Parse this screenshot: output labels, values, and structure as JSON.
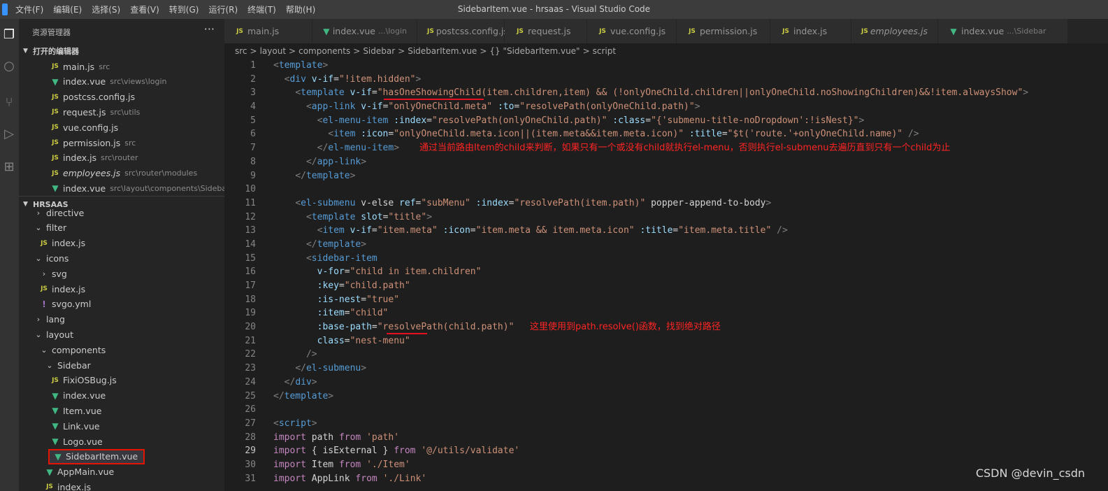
{
  "menu": [
    "文件(F)",
    "编辑(E)",
    "选择(S)",
    "查看(V)",
    "转到(G)",
    "运行(R)",
    "终端(T)",
    "帮助(H)"
  ],
  "window_title": "SidebarItem.vue - hrsaas - Visual Studio Code",
  "activity_icons": [
    "files-icon",
    "search-icon",
    "source-control-icon",
    "run-debug-icon",
    "extensions-icon"
  ],
  "explorer": {
    "title": "资源管理器",
    "more": "···",
    "open_editors_label": "打开的编辑器",
    "open_editors": [
      {
        "name": "main.js",
        "path": "src",
        "type": "js"
      },
      {
        "name": "index.vue",
        "path": "src\\views\\login",
        "type": "vue"
      },
      {
        "name": "postcss.config.js",
        "path": "",
        "type": "js"
      },
      {
        "name": "request.js",
        "path": "src\\utils",
        "type": "js"
      },
      {
        "name": "vue.config.js",
        "path": "",
        "type": "js"
      },
      {
        "name": "permission.js",
        "path": "src",
        "type": "js"
      },
      {
        "name": "index.js",
        "path": "src\\router",
        "type": "js"
      },
      {
        "name": "employees.js",
        "path": "src\\router\\modules",
        "type": "js",
        "italic": true
      },
      {
        "name": "index.vue",
        "path": "src\\layout\\components\\Sidebar",
        "type": "vue"
      }
    ],
    "project_label": "HRSAAS",
    "tree": [
      {
        "name": "directive",
        "type": "folder",
        "depth": 1,
        "open": false
      },
      {
        "name": "filter",
        "type": "folder",
        "depth": 1,
        "open": true
      },
      {
        "name": "index.js",
        "type": "js",
        "depth": 2
      },
      {
        "name": "icons",
        "type": "folder",
        "depth": 1,
        "open": true
      },
      {
        "name": "svg",
        "type": "folder",
        "depth": 2,
        "open": false
      },
      {
        "name": "index.js",
        "type": "js",
        "depth": 2
      },
      {
        "name": "svgo.yml",
        "type": "yml",
        "depth": 2
      },
      {
        "name": "lang",
        "type": "folder",
        "depth": 1,
        "open": false
      },
      {
        "name": "layout",
        "type": "folder",
        "depth": 1,
        "open": true
      },
      {
        "name": "components",
        "type": "folder",
        "depth": 2,
        "open": true
      },
      {
        "name": "Sidebar",
        "type": "folder",
        "depth": 3,
        "open": true
      },
      {
        "name": "FixiOSBug.js",
        "type": "js",
        "depth": 4
      },
      {
        "name": "index.vue",
        "type": "vue",
        "depth": 4
      },
      {
        "name": "Item.vue",
        "type": "vue",
        "depth": 4
      },
      {
        "name": "Link.vue",
        "type": "vue",
        "depth": 4
      },
      {
        "name": "Logo.vue",
        "type": "vue",
        "depth": 4
      },
      {
        "name": "SidebarItem.vue",
        "type": "vue",
        "depth": 4,
        "selected": true
      },
      {
        "name": "AppMain.vue",
        "type": "vue",
        "depth": 3
      },
      {
        "name": "index.js",
        "type": "js",
        "depth": 3
      }
    ]
  },
  "tabs": [
    {
      "name": "main.js",
      "type": "js",
      "sub": ""
    },
    {
      "name": "index.vue",
      "type": "vue",
      "sub": "...\\login"
    },
    {
      "name": "postcss.config.js",
      "type": "js",
      "sub": ""
    },
    {
      "name": "request.js",
      "type": "js",
      "sub": ""
    },
    {
      "name": "vue.config.js",
      "type": "js",
      "sub": ""
    },
    {
      "name": "permission.js",
      "type": "js",
      "sub": ""
    },
    {
      "name": "index.js",
      "type": "js",
      "sub": ""
    },
    {
      "name": "employees.js",
      "type": "js",
      "sub": "",
      "italic": true
    },
    {
      "name": "index.vue",
      "type": "vue",
      "sub": "...\\Sidebar"
    }
  ],
  "breadcrumb": [
    "src",
    ">",
    "layout",
    ">",
    "components",
    ">",
    "Sidebar",
    ">",
    "SidebarItem.vue",
    ">",
    "{} \"SidebarItem.vue\"",
    ">",
    "script"
  ],
  "editor": {
    "current_line": 29,
    "line_numbers": [
      1,
      2,
      3,
      4,
      5,
      6,
      7,
      8,
      9,
      10,
      11,
      12,
      13,
      14,
      15,
      16,
      17,
      18,
      19,
      20,
      21,
      22,
      23,
      24,
      25,
      26,
      27,
      28,
      29,
      30,
      31
    ],
    "lines": [
      "<template>",
      "  <div v-if=\"!item.hidden\">",
      "    <template v-if=\"hasOneShowingChild(item.children,item) && (!onlyOneChild.children||onlyOneChild.noShowingChildren)&&!item.alwaysShow\">",
      "      <app-link v-if=\"onlyOneChild.meta\" :to=\"resolvePath(onlyOneChild.path)\">",
      "        <el-menu-item :index=\"resolvePath(onlyOneChild.path)\" :class=\"{'submenu-title-noDropdown':!isNest}\">",
      "          <item :icon=\"onlyOneChild.meta.icon||(item.meta&&item.meta.icon)\" :title=\"$t('route.'+onlyOneChild.name)\" />",
      "        </el-menu-item>",
      "      </app-link>",
      "    </template>",
      "",
      "    <el-submenu v-else ref=\"subMenu\" :index=\"resolvePath(item.path)\" popper-append-to-body>",
      "      <template slot=\"title\">",
      "        <item v-if=\"item.meta\" :icon=\"item.meta && item.meta.icon\" :title=\"item.meta.title\" />",
      "      </template>",
      "      <sidebar-item",
      "        v-for=\"child in item.children\"",
      "        :key=\"child.path\"",
      "        :is-nest=\"true\"",
      "        :item=\"child\"",
      "        :base-path=\"resolvePath(child.path)\"",
      "        class=\"nest-menu\"",
      "      />",
      "    </el-submenu>",
      "  </div>",
      "</template>",
      "",
      "<script>",
      "import path from 'path'",
      "import { isExternal } from '@/utils/validate'",
      "import Item from './Item'",
      "import AppLink from './Link'"
    ],
    "annotations": [
      "通过当前路由Item的child来判断，如果只有一个或没有child就执行el-menu，否则执行el-submenu去遍历直到只有一个child为止",
      "这里使用到path.resolve()函数，找到绝对路径"
    ]
  },
  "watermark": "CSDN @devin_csdn",
  "colors": {
    "tag": "#569cd6",
    "attr": "#9cdcfe",
    "string": "#ce9178",
    "keyword": "#c586c0",
    "annotation": "#ff2424"
  }
}
